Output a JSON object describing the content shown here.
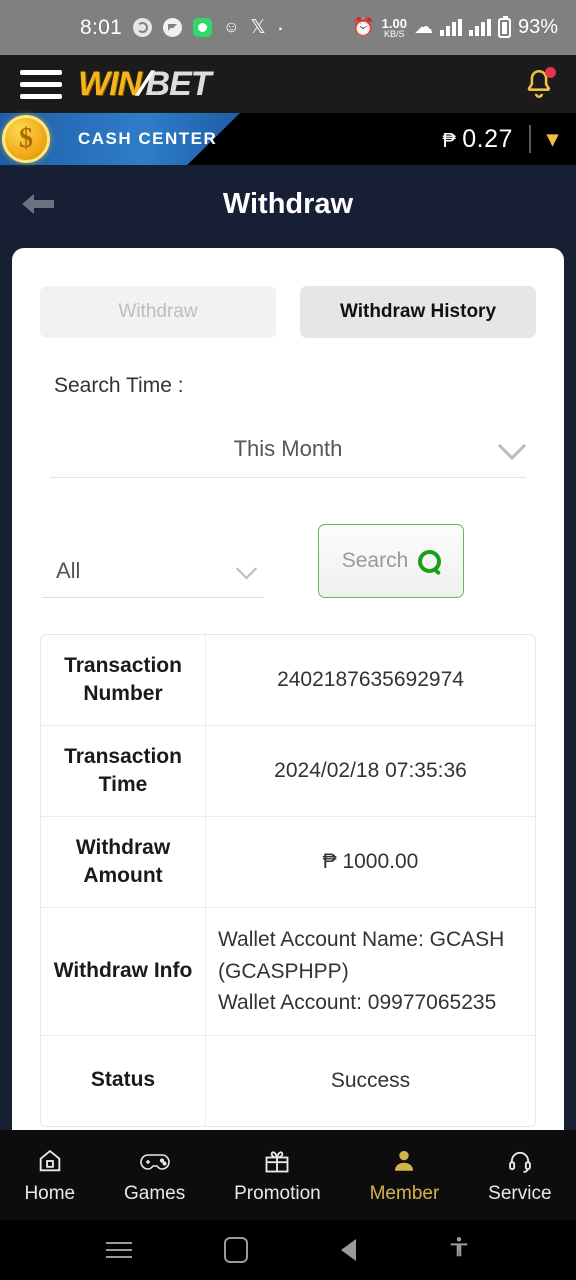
{
  "status_bar": {
    "time": "8:01",
    "app_icons": [
      "viber-icon",
      "messenger-icon",
      "whatsapp-icon",
      "discord-icon",
      "x-icon",
      "dot-icon"
    ],
    "alarm_icon": "alarm-icon",
    "net_speed_value": "1.00",
    "net_speed_unit": "KB/S",
    "wifi_icon": "wifi-icon",
    "signal_icon": "signal-bars-icon",
    "battery_text": "93%"
  },
  "header": {
    "menu_icon": "hamburger-menu-icon",
    "logo_win": "WIN",
    "logo_slash": "/",
    "logo_bet": "BET",
    "bell_icon": "notification-bell-icon",
    "bell_has_badge": true
  },
  "cash_bar": {
    "coin_symbol": "$",
    "label": "CASH CENTER",
    "currency": "₱",
    "balance": "0.27",
    "chevron_icon": "chevron-down-icon",
    "accent_color": "#f0c040",
    "banner_color": "#2f7dc9"
  },
  "page": {
    "back_icon": "back-arrow-icon",
    "title": "Withdraw"
  },
  "tabs": [
    {
      "label": "Withdraw",
      "active": false
    },
    {
      "label": "Withdraw History",
      "active": true
    }
  ],
  "filters": {
    "search_time_label": "Search Time :",
    "period_value": "This Month",
    "period_chevron": "chevron-down-icon",
    "type_value": "All",
    "type_chevron": "chevron-down-icon",
    "search_button_label": "Search",
    "search_icon": "search-magnifier-icon",
    "search_accent_color": "#18a018"
  },
  "transaction": {
    "rows": [
      {
        "key": "Transaction Number",
        "value": "2402187635692974",
        "align": "center"
      },
      {
        "key": "Transaction Time",
        "value": "2024/02/18 07:35:36",
        "align": "center"
      },
      {
        "key": "Withdraw Amount",
        "value": "₱ 1000.00",
        "align": "center"
      },
      {
        "key": "Withdraw Info",
        "value": "Wallet Account Name: GCASH (GCASPHPP)\nWallet Account: 09977065235",
        "align": "left"
      },
      {
        "key": "Status",
        "value": "Success",
        "align": "center"
      }
    ]
  },
  "bottom_nav": [
    {
      "label": "Home",
      "icon": "home-icon",
      "active": false
    },
    {
      "label": "Games",
      "icon": "gamepad-icon",
      "active": false
    },
    {
      "label": "Promotion",
      "icon": "gift-icon",
      "active": false
    },
    {
      "label": "Member",
      "icon": "person-icon",
      "active": true
    },
    {
      "label": "Service",
      "icon": "headset-icon",
      "active": false
    }
  ],
  "android_nav": [
    {
      "icon": "recent-apps-icon"
    },
    {
      "icon": "home-square-icon"
    },
    {
      "icon": "back-triangle-icon"
    },
    {
      "icon": "accessibility-icon"
    }
  ]
}
